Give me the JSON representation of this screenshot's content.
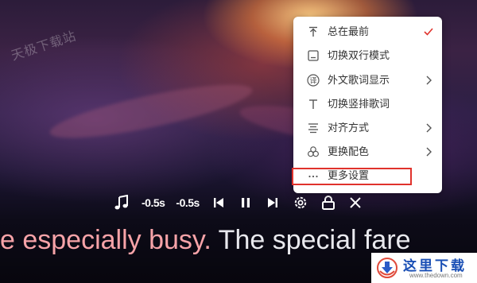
{
  "watermark": "天极下载站",
  "toolbar": {
    "offset_back": "-0.5s",
    "offset_forward": "-0.5s"
  },
  "lyric": {
    "played": "e especially busy.",
    "rest": " The special fare"
  },
  "menu": {
    "items": [
      {
        "label": "总在最前",
        "icon": "pin-top-icon",
        "checked": true
      },
      {
        "label": "切换双行模式",
        "icon": "two-line-icon"
      },
      {
        "label": "外文歌词显示",
        "icon": "translate-icon",
        "submenu": true
      },
      {
        "label": "切换竖排歌词",
        "icon": "text-t-icon"
      },
      {
        "label": "对齐方式",
        "icon": "align-icon",
        "submenu": true
      },
      {
        "label": "更换配色",
        "icon": "palette-icon",
        "submenu": true
      },
      {
        "label": "更多设置",
        "icon": "more-dots-icon",
        "highlighted": true
      }
    ]
  },
  "translate_glyph": "译",
  "logo": {
    "name": "这里下载",
    "url": "www.thedown.com"
  },
  "colors": {
    "played_lyric": "#f7a3a8",
    "check_mark": "#e0322c",
    "highlight_box": "#e0322c"
  }
}
